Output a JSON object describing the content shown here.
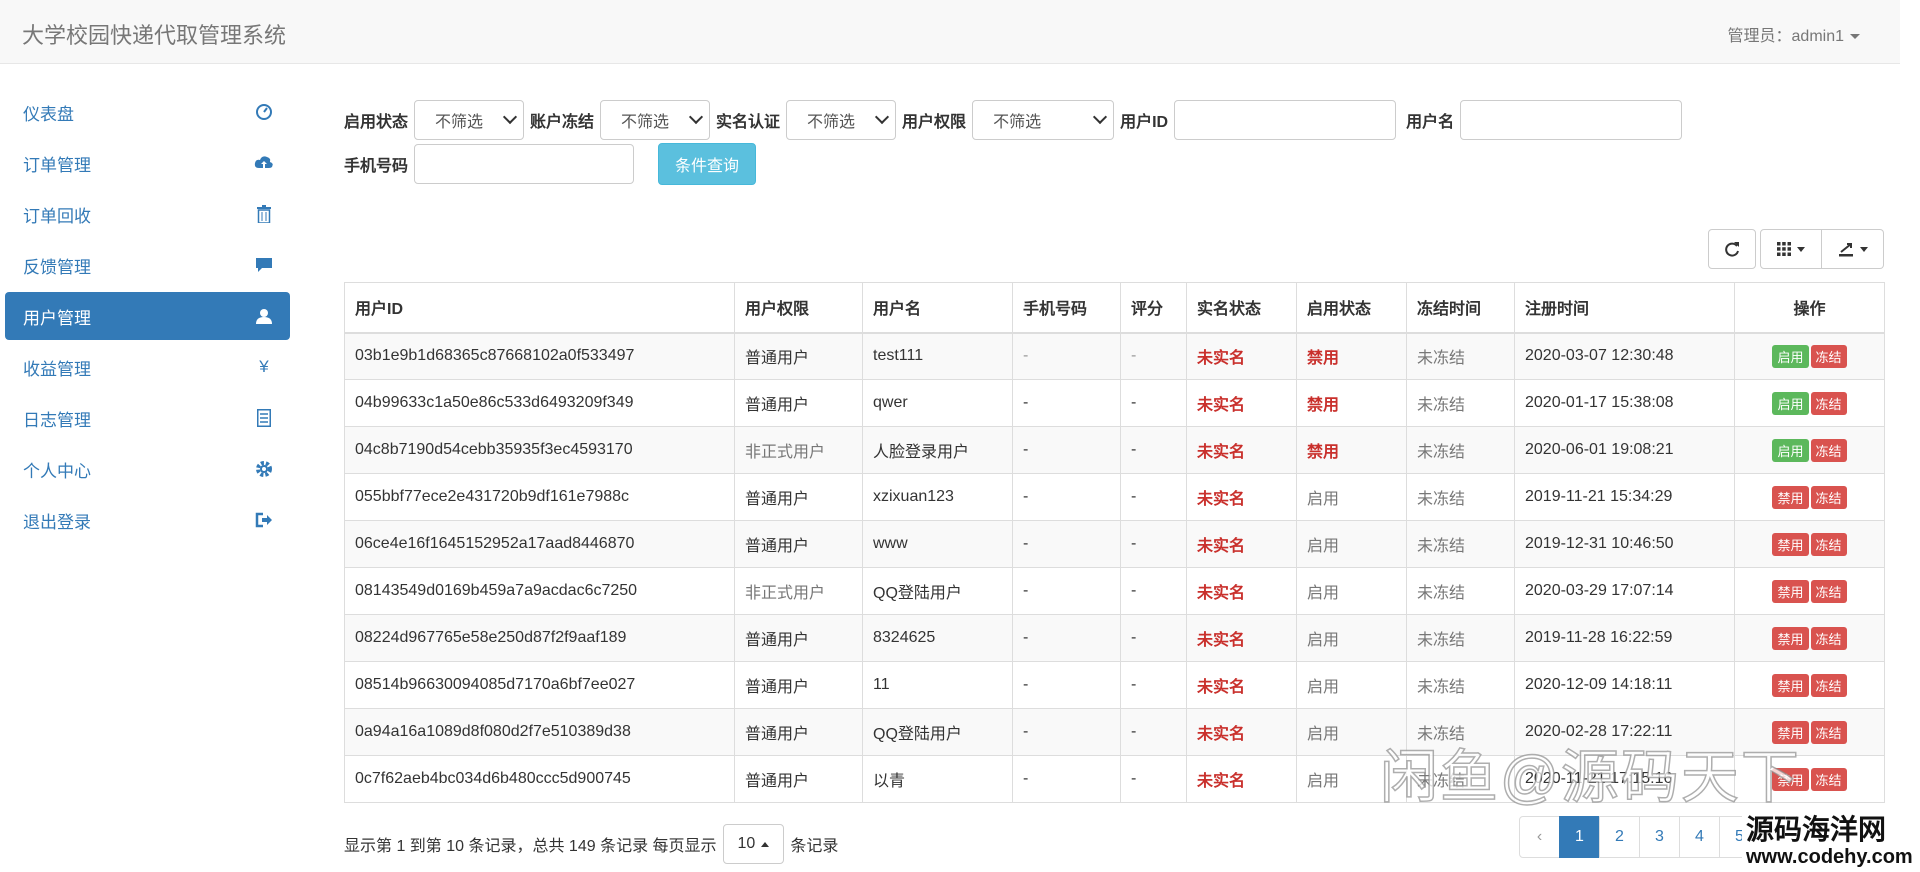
{
  "header": {
    "title": "大学校园快递代取管理系统",
    "admin_label": "管理员：admin1"
  },
  "sidebar": {
    "items": [
      {
        "label": "仪表盘",
        "icon": "dashboard-icon"
      },
      {
        "label": "订单管理",
        "icon": "cloud-upload-icon"
      },
      {
        "label": "订单回收",
        "icon": "trash-icon"
      },
      {
        "label": "反馈管理",
        "icon": "comment-icon"
      },
      {
        "label": "用户管理",
        "icon": "user-icon",
        "active": true
      },
      {
        "label": "收益管理",
        "icon": "yen-icon"
      },
      {
        "label": "日志管理",
        "icon": "list-icon"
      },
      {
        "label": "个人中心",
        "icon": "gear-icon"
      },
      {
        "label": "退出登录",
        "icon": "logout-icon"
      }
    ]
  },
  "filters": {
    "enable_status_label": "启用状态",
    "enable_status_value": "不筛选",
    "freeze_label": "账户冻结",
    "freeze_value": "不筛选",
    "realname_label": "实名认证",
    "realname_value": "不筛选",
    "permission_label": "用户权限",
    "permission_value": "不筛选",
    "user_id_label": "用户ID",
    "user_id_value": "",
    "username_label": "用户名",
    "username_value": "",
    "phone_label": "手机号码",
    "phone_value": "",
    "query_button": "条件查询"
  },
  "table": {
    "columns": [
      "用户ID",
      "用户权限",
      "用户名",
      "手机号码",
      "评分",
      "实名状态",
      "启用状态",
      "冻结时间",
      "注册时间",
      "操作"
    ],
    "rows": [
      {
        "id": "03b1e9b1d68365c87668102a0f533497",
        "perm": "普通用户",
        "name": "test111",
        "phone": "-",
        "score": "-",
        "realname": "未实名",
        "enable": "禁用",
        "freeze": "未冻结",
        "reg": "2020-03-07 12:30:48",
        "btn1": "启用",
        "btn2": "冻结"
      },
      {
        "id": "04b99633c1a50e86c533d6493209f349",
        "perm": "普通用户",
        "name": "qwer",
        "phone": "-",
        "score": "-",
        "realname": "未实名",
        "enable": "禁用",
        "freeze": "未冻结",
        "reg": "2020-01-17 15:38:08",
        "btn1": "启用",
        "btn2": "冻结"
      },
      {
        "id": "04c8b7190d54cebb35935f3ec4593170",
        "perm": "非正式用户",
        "name": "人脸登录用户",
        "phone": "-",
        "score": "-",
        "realname": "未实名",
        "enable": "禁用",
        "freeze": "未冻结",
        "reg": "2020-06-01 19:08:21",
        "btn1": "启用",
        "btn2": "冻结"
      },
      {
        "id": "055bbf77ece2e431720b9df161e7988c",
        "perm": "普通用户",
        "name": "xzixuan123",
        "phone": "-",
        "score": "-",
        "realname": "未实名",
        "enable": "启用",
        "freeze": "未冻结",
        "reg": "2019-11-21 15:34:29",
        "btn1": "禁用",
        "btn2": "冻结"
      },
      {
        "id": "06ce4e16f1645152952a17aad8446870",
        "perm": "普通用户",
        "name": "www",
        "phone": "-",
        "score": "-",
        "realname": "未实名",
        "enable": "启用",
        "freeze": "未冻结",
        "reg": "2019-12-31 10:46:50",
        "btn1": "禁用",
        "btn2": "冻结"
      },
      {
        "id": "08143549d0169b459a7a9acdac6c7250",
        "perm": "非正式用户",
        "name": "QQ登陆用户",
        "phone": "-",
        "score": "-",
        "realname": "未实名",
        "enable": "启用",
        "freeze": "未冻结",
        "reg": "2020-03-29 17:07:14",
        "btn1": "禁用",
        "btn2": "冻结"
      },
      {
        "id": "08224d967765e58e250d87f2f9aaf189",
        "perm": "普通用户",
        "name": "8324625",
        "phone": "-",
        "score": "-",
        "realname": "未实名",
        "enable": "启用",
        "freeze": "未冻结",
        "reg": "2019-11-28 16:22:59",
        "btn1": "禁用",
        "btn2": "冻结"
      },
      {
        "id": "08514b96630094085d7170a6bf7ee027",
        "perm": "普通用户",
        "name": "11",
        "phone": "-",
        "score": "-",
        "realname": "未实名",
        "enable": "启用",
        "freeze": "未冻结",
        "reg": "2020-12-09 14:18:11",
        "btn1": "禁用",
        "btn2": "冻结"
      },
      {
        "id": "0a94a16a1089d8f080d2f7e510389d38",
        "perm": "普通用户",
        "name": "QQ登陆用户",
        "phone": "-",
        "score": "-",
        "realname": "未实名",
        "enable": "启用",
        "freeze": "未冻结",
        "reg": "2020-02-28 17:22:11",
        "btn1": "禁用",
        "btn2": "冻结"
      },
      {
        "id": "0c7f62aeb4bc034d6b480ccc5d900745",
        "perm": "普通用户",
        "name": "以青",
        "phone": "-",
        "score": "-",
        "realname": "未实名",
        "enable": "启用",
        "freeze": "未冻结",
        "reg": "2020-11-21 17:15:16",
        "btn1": "禁用",
        "btn2": "冻结"
      }
    ]
  },
  "footer": {
    "summary": "显示第 1 到第 10 条记录，总共 149 条记录 每页显示",
    "page_size": "10",
    "suffix": "条记录",
    "pages": [
      "‹",
      "1",
      "2",
      "3",
      "4",
      "5"
    ]
  },
  "watermark": {
    "text1": "闲鱼@源码天下",
    "text2": "源码海洋网",
    "url": "www.codehy.com"
  },
  "colors": {
    "primary": "#337ab7",
    "info": "#5bc0de",
    "success": "#5cb85c",
    "danger": "#d9534f"
  }
}
